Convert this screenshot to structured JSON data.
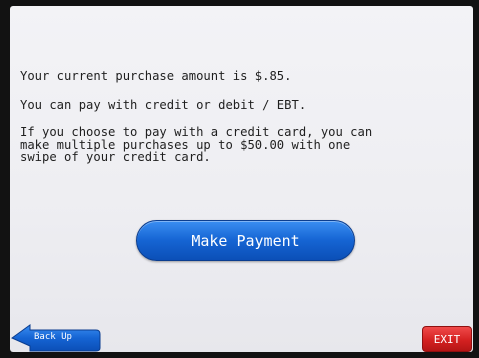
{
  "messages": {
    "amount": "Your current purchase amount is $.85.",
    "methods": "You can pay with credit or debit / EBT.",
    "credit_info": "If you choose to pay with a credit card, you can\nmake multiple purchases up to $50.00 with one\nswipe of your credit card."
  },
  "buttons": {
    "make_payment": "Make Payment",
    "back_up": "Back Up",
    "exit": "EXIT"
  },
  "colors": {
    "primary_button": "#1564d3",
    "back_button": "#1564d3",
    "exit_button": "#d42121",
    "background": "#f0f0f4"
  },
  "icons": {
    "back": "left-arrow-icon"
  }
}
